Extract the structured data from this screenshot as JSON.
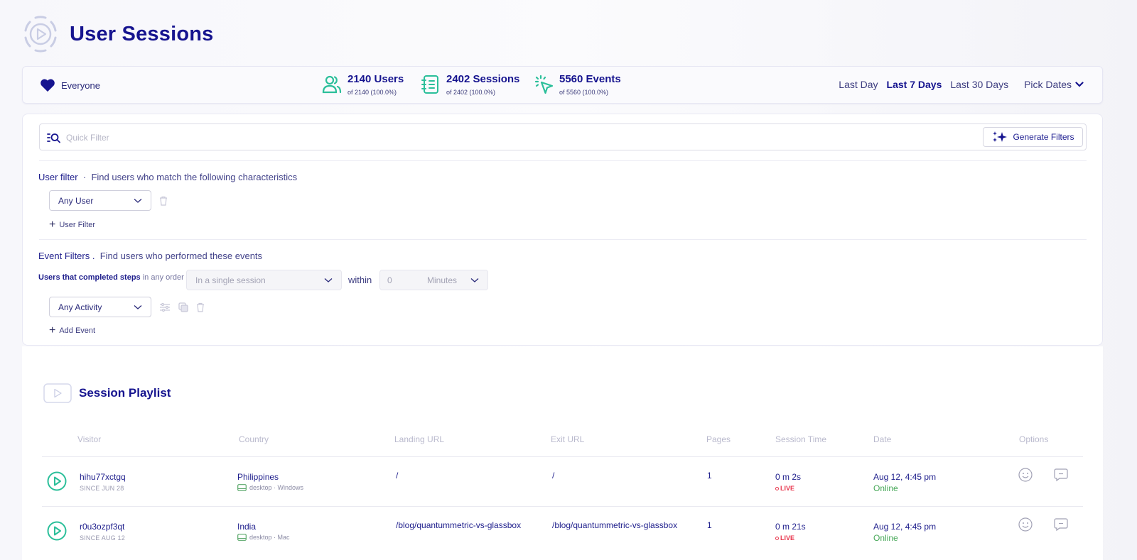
{
  "header": {
    "title": "User Sessions",
    "logo_icon": "play-circle-icon"
  },
  "stats_bar": {
    "segment": {
      "icon": "heart-icon",
      "label": "Everyone"
    },
    "stats": [
      {
        "icon": "users-icon",
        "value": "2140 Users",
        "sub": "of 2140 (100.0%)"
      },
      {
        "icon": "notebook-icon",
        "value": "2402 Sessions",
        "sub": "of 2402 (100.0%)"
      },
      {
        "icon": "cursor-click-icon",
        "value": "5560 Events",
        "sub": "of 5560 (100.0%)"
      }
    ],
    "ranges": [
      {
        "label": "Last Day",
        "active": false
      },
      {
        "label": "Last 7 Days",
        "active": true
      },
      {
        "label": "Last 30 Days",
        "active": false
      }
    ],
    "pick_dates": "Pick Dates"
  },
  "filters": {
    "quick_filter_placeholder": "Quick Filter",
    "quick_filter_value": "",
    "generate_button": "Generate Filters",
    "user_filter": {
      "title": "User filter",
      "separator": "·",
      "description": "Find users who match the following characteristics",
      "select_value": "Any User",
      "add_label": "User Filter"
    },
    "event_filter": {
      "title": "Event Filters .",
      "description": "Find users who performed these events",
      "steps_label": "Users that completed steps",
      "order_label": "in any order",
      "session_select": "In a single session",
      "within_label": "within",
      "within_value": "0",
      "unit_select": "Minutes",
      "activity_select": "Any Activity",
      "add_label": "Add Event"
    }
  },
  "playlist": {
    "title": "Session Playlist",
    "columns": [
      "Visitor",
      "Country",
      "Landing URL",
      "Exit URL",
      "Pages",
      "Session Time",
      "Date",
      "Options"
    ],
    "rows": [
      {
        "visitor": "hihu77xctgq",
        "since": "SINCE JUN 28",
        "country": "Philippines",
        "device": "desktop · Windows",
        "landing_url": "/",
        "exit_url": "/",
        "pages": "1",
        "session_time": "0 m 2s",
        "live": "LIVE",
        "date": "Aug 12, 4:45 pm",
        "status": "Online"
      },
      {
        "visitor": "r0u3ozpf3qt",
        "since": "SINCE AUG 12",
        "country": "India",
        "device": "desktop · Mac",
        "landing_url": "/blog/quantummetric-vs-glassbox",
        "exit_url": "/blog/quantummetric-vs-glassbox",
        "pages": "1",
        "session_time": "0 m 21s",
        "live": "LIVE",
        "date": "Aug 12, 4:45 pm",
        "status": "Online"
      }
    ]
  },
  "colors": {
    "brand": "#16148f",
    "accent_green": "#2bbf9a",
    "live_red": "#e8364d",
    "online_green": "#47a858"
  }
}
